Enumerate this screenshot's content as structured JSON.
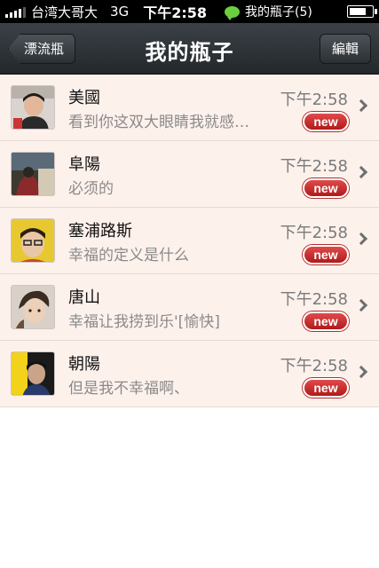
{
  "status_bar": {
    "carrier": "台湾大哥大",
    "network": "3G",
    "time": "下午2:58",
    "notification": "我的瓶子(5)",
    "battery_level": 0.8
  },
  "nav": {
    "back_label": "漂流瓶",
    "title": "我的瓶子",
    "edit_label": "編輯"
  },
  "bottles": [
    {
      "name": "美國",
      "preview": "看到你这双大眼睛我就感…",
      "time": "下午2:58",
      "badge": "new"
    },
    {
      "name": "阜陽",
      "preview": "必须的",
      "time": "下午2:58",
      "badge": "new"
    },
    {
      "name": "塞浦路斯",
      "preview": "幸福的定义是什么",
      "time": "下午2:58",
      "badge": "new"
    },
    {
      "name": "唐山",
      "preview": "幸福让我捞到乐'[愉快]",
      "time": "下午2:58",
      "badge": "new"
    },
    {
      "name": "朝陽",
      "preview": "但是我不幸福啊、",
      "time": "下午2:58",
      "badge": "new"
    }
  ],
  "colors": {
    "row_bg": "#fdf1ec",
    "badge_red": "#d03030",
    "nav_dark": "#2b3034"
  }
}
